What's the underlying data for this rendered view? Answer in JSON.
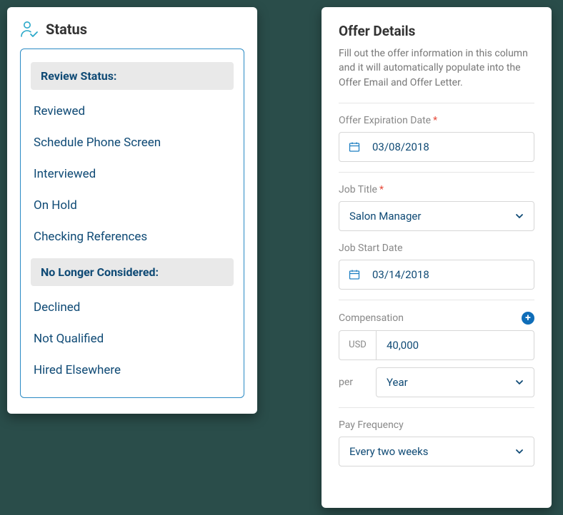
{
  "status": {
    "title": "Status",
    "groups": [
      {
        "label": "Review Status:",
        "items": [
          "Reviewed",
          "Schedule Phone Screen",
          "Interviewed",
          "On Hold",
          "Checking References"
        ]
      },
      {
        "label": "No Longer Considered:",
        "items": [
          "Declined",
          "Not Qualified",
          "Hired Elsewhere"
        ]
      }
    ]
  },
  "offer": {
    "title": "Offer Details",
    "description": "Fill out the offer information in this column and it will automatically populate into the Offer Email and Offer Letter.",
    "expiration": {
      "label": "Offer Expiration Date",
      "required": true,
      "value": "03/08/2018"
    },
    "jobTitle": {
      "label": "Job Title",
      "required": true,
      "value": "Salon Manager"
    },
    "startDate": {
      "label": "Job Start Date",
      "value": "03/14/2018"
    },
    "compensation": {
      "label": "Compensation",
      "currency": "USD",
      "amount": "40,000",
      "perLabel": "per",
      "period": "Year"
    },
    "payFrequency": {
      "label": "Pay Frequency",
      "value": "Every two weeks"
    }
  }
}
